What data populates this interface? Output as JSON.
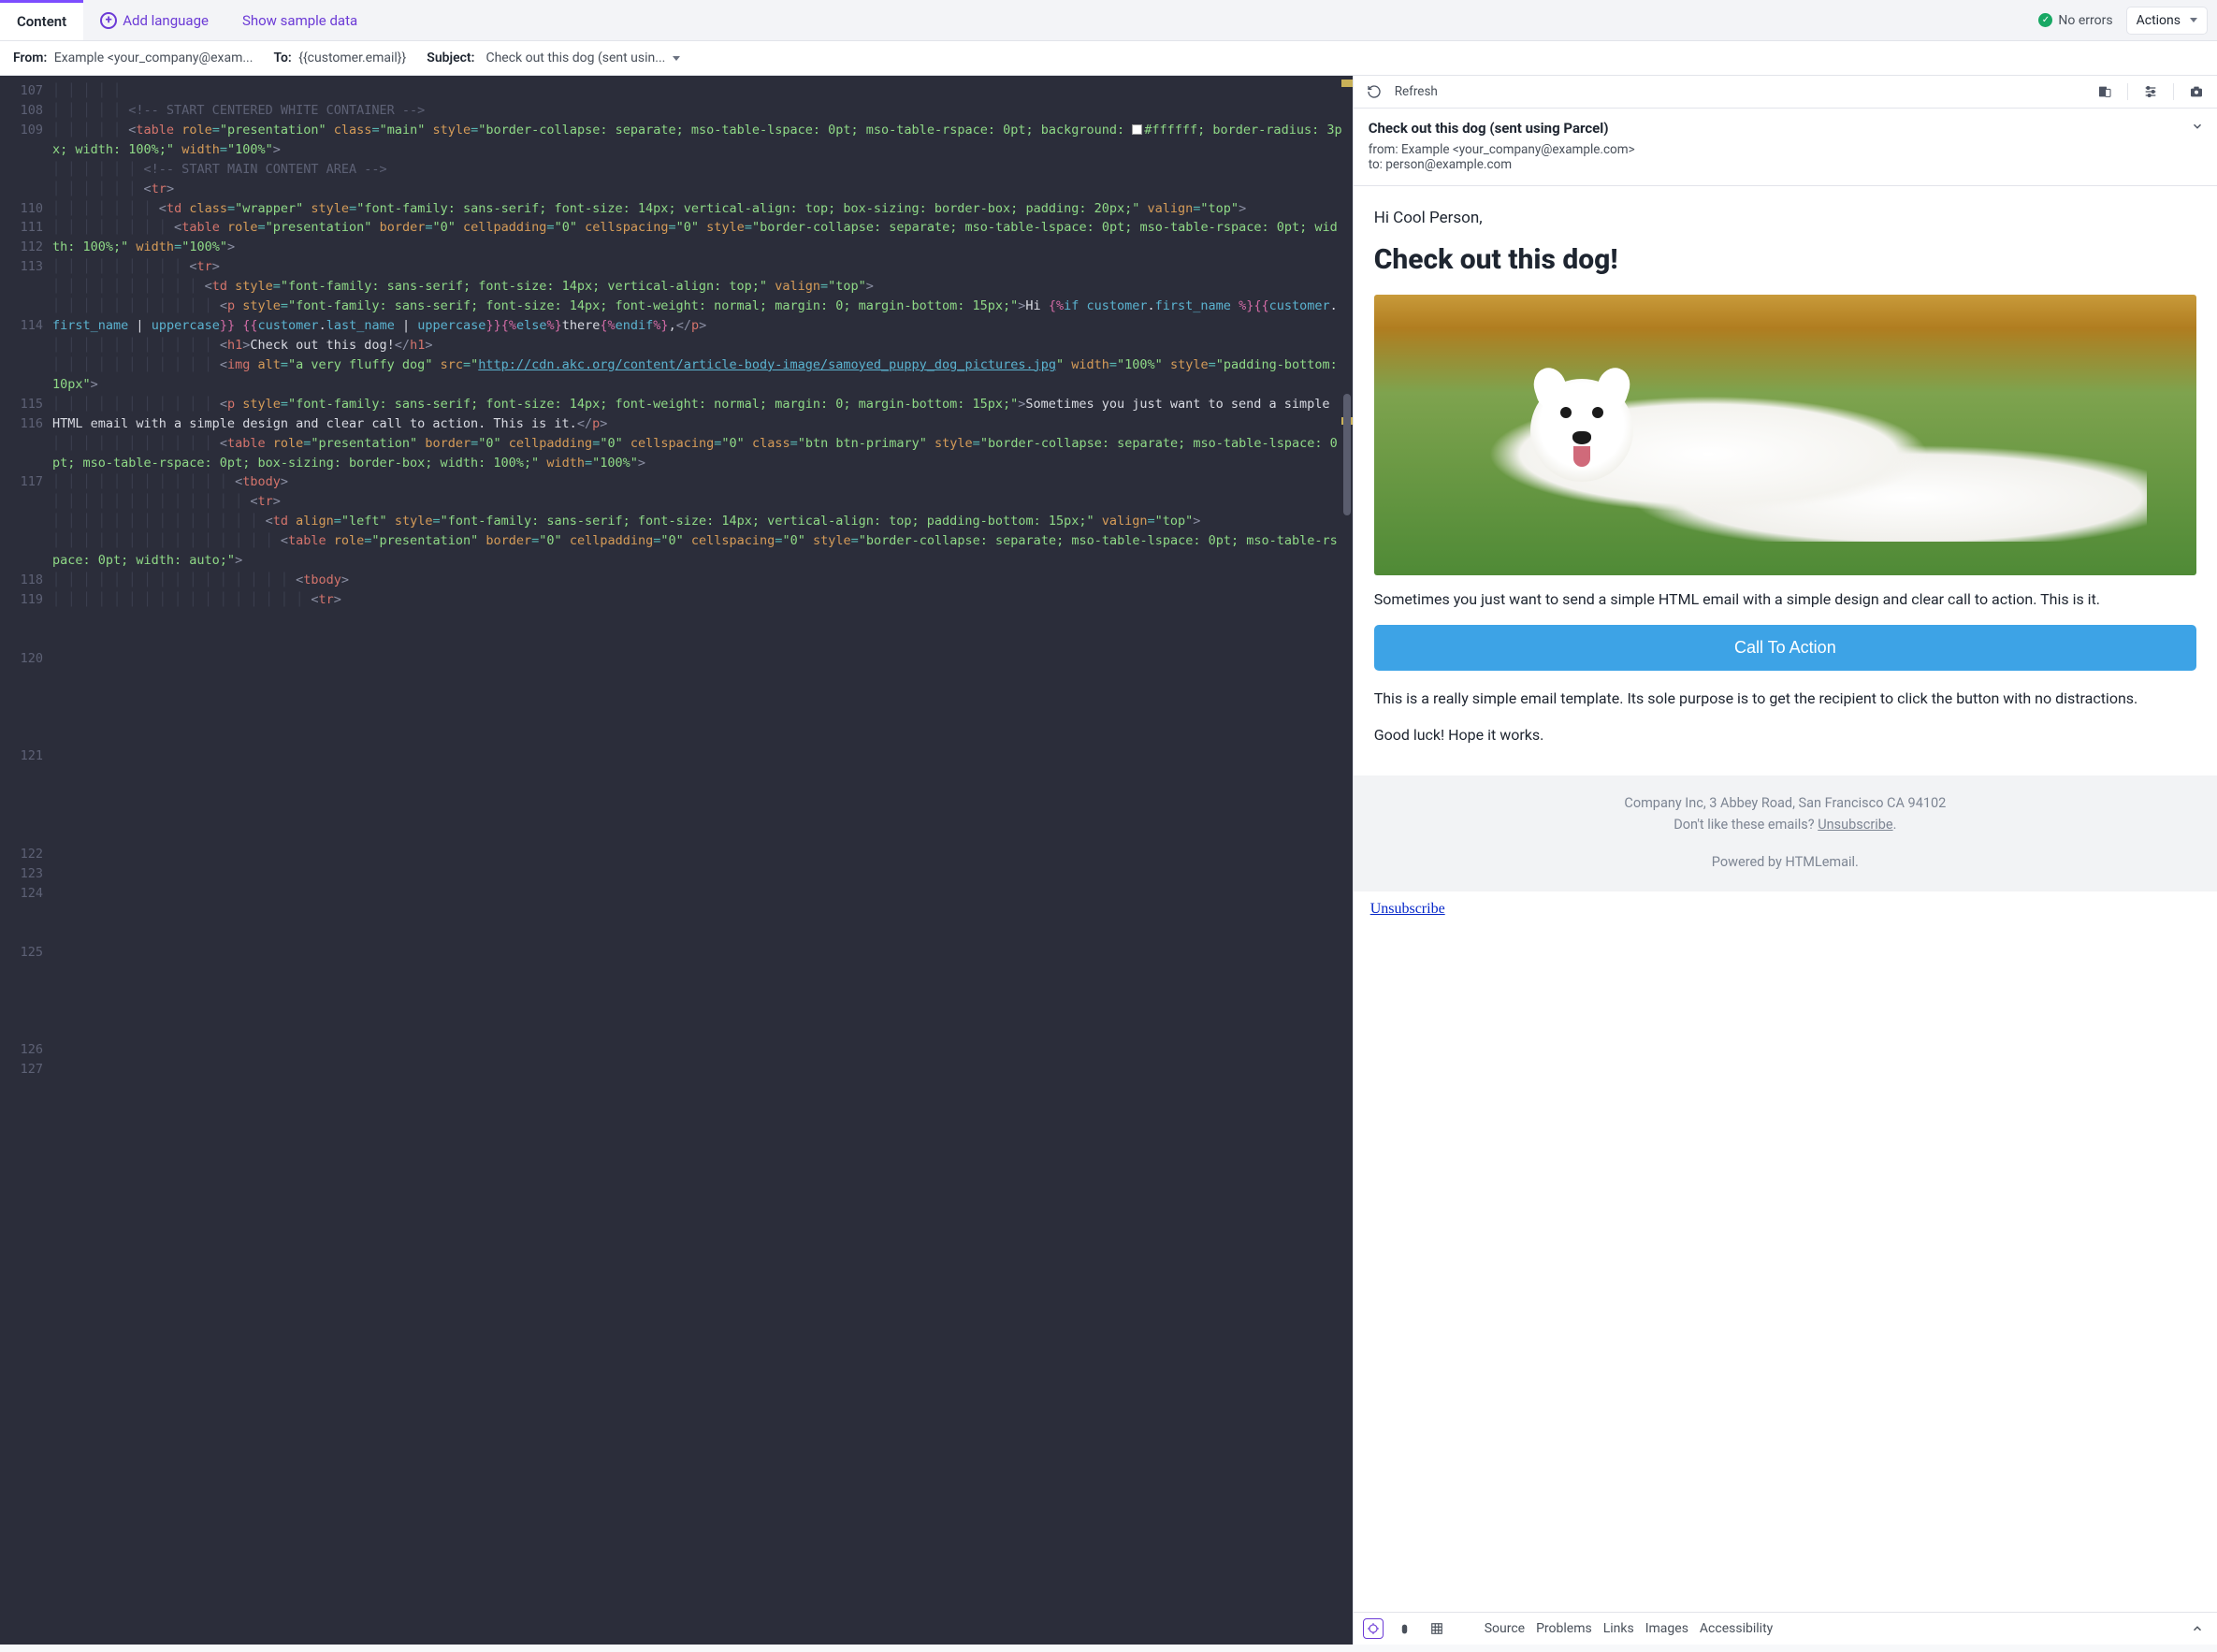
{
  "top": {
    "tab_content": "Content",
    "add_language": "Add language",
    "show_sample": "Show sample data",
    "no_errors": "No errors",
    "actions": "Actions"
  },
  "meta": {
    "from_label": "From:",
    "from_value": "Example <your_company@exam...",
    "to_label": "To:",
    "to_value": "{{customer.email}}",
    "subject_label": "Subject:",
    "subject_value": "Check out this dog (sent usin..."
  },
  "gutter": [
    "107",
    "108",
    "109",
    "",
    "110",
    "111",
    "112",
    "113",
    "",
    "114",
    "",
    "115",
    "116",
    "",
    "117",
    "",
    "",
    "118",
    "119",
    "",
    "120",
    "",
    "",
    "121",
    "",
    "",
    "122",
    "123",
    "124",
    "",
    "125",
    "",
    "",
    "126",
    "127",
    ""
  ],
  "preview": {
    "refresh": "Refresh",
    "title": "Check out this dog (sent using Parcel)",
    "from_line": "from: Example <your_company@example.com>",
    "to_line": "to: person@example.com",
    "greeting": "Hi Cool Person,",
    "headline": "Check out this dog!",
    "para1": "Sometimes you just want to send a simple HTML email with a simple design and clear call to action. This is it.",
    "cta": "Call To Action",
    "para2": "This is a really simple email template. Its sole purpose is to get the recipient to click the button with no distractions.",
    "para3": "Good luck! Hope it works.",
    "footer_addr": "Company Inc, 3 Abbey Road, San Francisco CA 94102",
    "footer_dont": "Don't like these emails? ",
    "footer_unsub": "Unsubscribe",
    "footer_dot": ".",
    "footer_powered": "Powered by HTMLemail.",
    "unsub": "Unsubscribe"
  },
  "bottom_tabs": [
    "Source",
    "Problems",
    "Links",
    "Images",
    "Accessibility"
  ]
}
